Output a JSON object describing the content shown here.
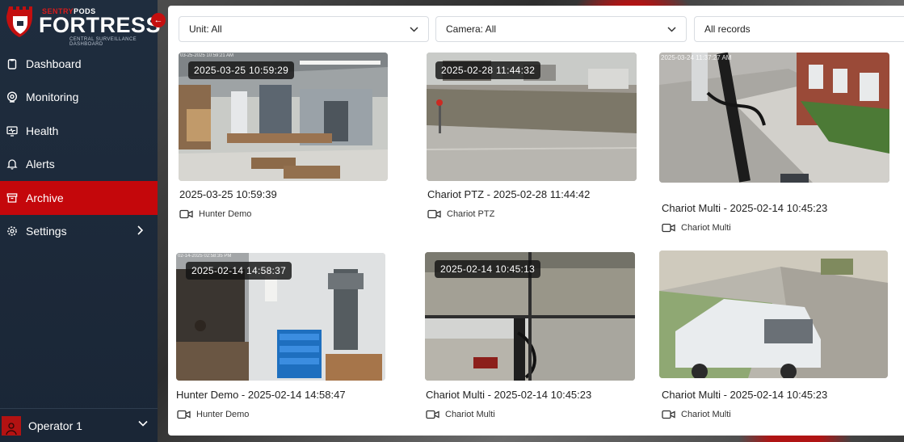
{
  "brand": {
    "top_left": "SENTRY",
    "top_right": "PODS",
    "name": "FORTRESS",
    "tagline": "CENTRAL SURVEILLANCE DASHBOARD",
    "accent_color": "#c4070b",
    "sidebar_color": "#1f2d3e"
  },
  "sidebar": {
    "collapse_icon": "arrow-left-icon",
    "items": [
      {
        "label": "Dashboard",
        "icon": "clipboard-icon",
        "active": false
      },
      {
        "label": "Monitoring",
        "icon": "target-icon",
        "active": false
      },
      {
        "label": "Health",
        "icon": "monitor-pulse-icon",
        "active": false
      },
      {
        "label": "Alerts",
        "icon": "bell-icon",
        "active": false
      },
      {
        "label": "Archive",
        "icon": "archive-box-icon",
        "active": true
      },
      {
        "label": "Settings",
        "icon": "gear-icon",
        "active": false,
        "has_submenu": true
      }
    ],
    "user": {
      "name": "Operator 1",
      "icon": "user-icon"
    }
  },
  "filters": {
    "unit": "Unit: All",
    "camera": "Camera: All",
    "records": "All records"
  },
  "recordings": [
    {
      "badge": "2025-03-25 10:59:29",
      "title": "2025-03-25 10:59:39",
      "camera": "Hunter Demo",
      "overlay": "03-25-2025 10:59:21 AM",
      "scene": "workshop"
    },
    {
      "badge": "2025-02-28 11:44:32",
      "title": "Chariot PTZ - 2025-02-28 11:44:42",
      "camera": "Chariot PTZ",
      "overlay": "",
      "scene": "lot"
    },
    {
      "badge": "",
      "title": "Chariot Multi - 2025-02-14 10:45:23",
      "camera": "Chariot Multi",
      "overlay": "2025-03-24 11:37:27 AM",
      "scene": "sidewalk"
    },
    {
      "badge": "2025-02-14 14:58:37",
      "title": "Hunter Demo - 2025-02-14 14:58:47",
      "camera": "Hunter Demo",
      "overlay": "02-14-2025 02:58:35 PM",
      "scene": "drillpress"
    },
    {
      "badge": "2025-02-14 10:45:13",
      "title": "Chariot Multi - 2025-02-14 10:45:23",
      "camera": "Chariot Multi",
      "overlay": "",
      "scene": "multi"
    },
    {
      "badge": "",
      "title": "Chariot Multi - 2025-02-14 10:45:23",
      "camera": "Chariot Multi",
      "overlay": "",
      "scene": "van"
    }
  ]
}
